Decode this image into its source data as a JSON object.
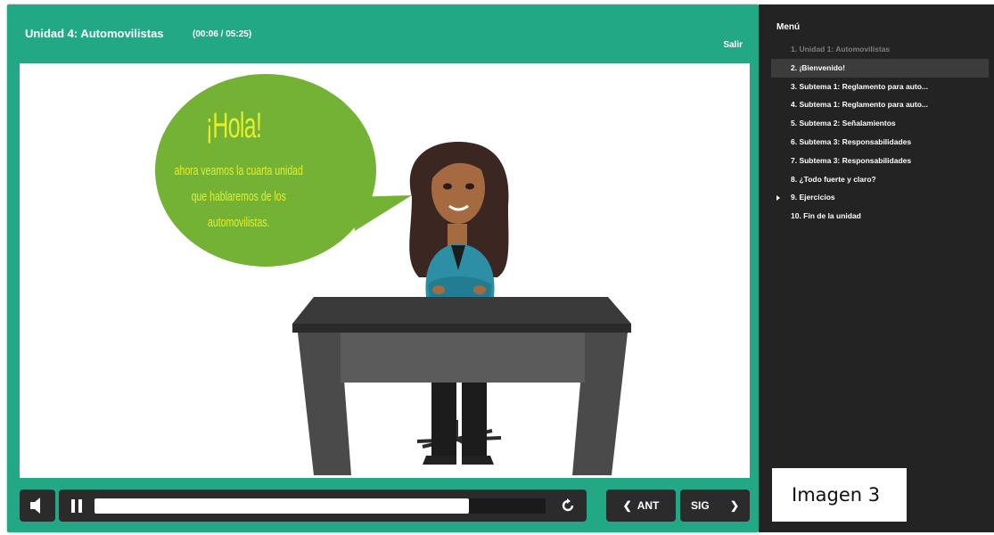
{
  "player": {
    "title": "Unidad 4: Automovilistas",
    "time": "(00:06 / 05:25)",
    "exit_label": "Salir",
    "progress_fraction": 0.83
  },
  "slide": {
    "greeting": "¡Hola!",
    "message_lines": [
      "ahora veamos la cuarta unidad",
      "que hablaremos de los",
      "automovilistas."
    ],
    "bubble_color": "#74b236",
    "text_color": "#e4ef2a"
  },
  "controls": {
    "volume_icon": "speaker-icon",
    "pause_icon": "pause-icon",
    "replay_icon": "replay-icon",
    "prev_label": "ANT",
    "next_label": "SIG"
  },
  "menu": {
    "title": "Menú",
    "items": [
      {
        "label": "1. Unidad 1: Automovilistas",
        "state": "dim"
      },
      {
        "label": "2. ¡Bienvenido!",
        "state": "selected"
      },
      {
        "label": "3. Subtema 1: Reglamento para auto...",
        "state": "normal"
      },
      {
        "label": "4. Subtema 1: Reglamento para auto...",
        "state": "normal"
      },
      {
        "label": "5. Subtema 2: Señalamientos",
        "state": "normal"
      },
      {
        "label": "6. Subtema 3: Responsabilidades",
        "state": "normal"
      },
      {
        "label": "7. Subtema 3: Responsabilidades",
        "state": "normal"
      },
      {
        "label": "8. ¿Todo fuerte y claro?",
        "state": "normal"
      },
      {
        "label": "9. Ejercicios",
        "state": "expandable"
      },
      {
        "label": "10. Fin de la unidad",
        "state": "normal"
      }
    ]
  },
  "caption": "Imagen 3",
  "colors": {
    "accent": "#23a886",
    "sidebar": "#232323",
    "control": "#2b2b2b"
  }
}
